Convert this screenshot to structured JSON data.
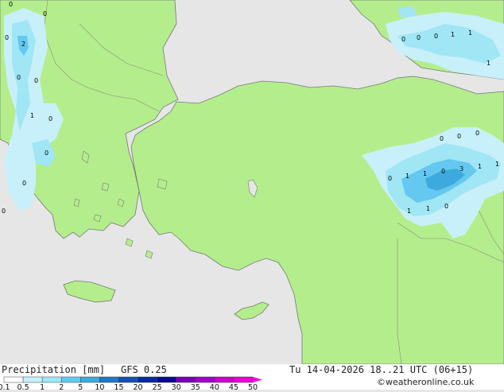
{
  "map": {
    "values": [
      {
        "t": "0"
      },
      {
        "t": "0"
      },
      {
        "t": "0"
      },
      {
        "t": "2"
      },
      {
        "t": "0"
      },
      {
        "t": "0"
      },
      {
        "t": "1"
      },
      {
        "t": "0"
      },
      {
        "t": "0"
      },
      {
        "t": "0"
      },
      {
        "t": "0"
      },
      {
        "t": "0"
      },
      {
        "t": "0"
      },
      {
        "t": "0"
      },
      {
        "t": "1"
      },
      {
        "t": "1"
      },
      {
        "t": "1"
      },
      {
        "t": "0"
      },
      {
        "t": "0"
      },
      {
        "t": "0"
      },
      {
        "t": "0"
      },
      {
        "t": "1"
      },
      {
        "t": "1"
      },
      {
        "t": "0"
      },
      {
        "t": "3"
      },
      {
        "t": "1"
      },
      {
        "t": "1"
      },
      {
        "t": "1"
      },
      {
        "t": "1"
      },
      {
        "t": "0"
      }
    ]
  },
  "footer": {
    "title": "Precipitation [mm]",
    "model": "GFS 0.25",
    "datetime": "Tu 14-04-2026 18..21 UTC (06+15)",
    "credit": "©weatheronline.co.uk"
  },
  "legend": {
    "ticks": [
      "0.1",
      "0.5",
      "1",
      "2",
      "5",
      "10",
      "15",
      "20",
      "25",
      "30",
      "35",
      "40",
      "45",
      "50"
    ],
    "colors": [
      "#ffffff",
      "#c8f0fa",
      "#a0e6f5",
      "#64c8f0",
      "#3caadc",
      "#1e78c8",
      "#1450b4",
      "#0a28a0",
      "#0a0a8c",
      "#7800b4",
      "#a000c8",
      "#c800c8",
      "#e600d2",
      "#ff00e6"
    ]
  }
}
